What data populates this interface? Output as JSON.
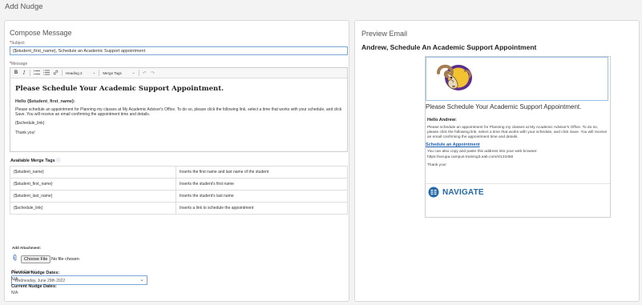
{
  "page": {
    "title": "Add Nudge"
  },
  "compose": {
    "title": "Compose Message",
    "subject_label": "Subject",
    "subject_value": "{$student_first_name}, Schedule an Academic Support appointment",
    "message_label": "Message",
    "toolbar": {
      "bold": "B",
      "italic": "I",
      "heading_select": "Heading 2",
      "merge_tags_select": "Merge Tags"
    },
    "editor": {
      "heading": "Please Schedule Your Academic Support Appointment.",
      "hello": "Hello {$student_first_name}:",
      "body": "Please schedule an appointment for Planning my classes at My Academic Advisor's Office. To do so, please click the following link, select a time that works with your schedule, and click Save. You will receive an email confirming the appointment time and details.",
      "link_tag": "{$schedule_link}",
      "thanks": "Thank you!"
    },
    "merge_tags_title": "Available Merge Tags",
    "merge_tags": [
      {
        "tag": "{$student_name}",
        "desc": "Inserts the first name and last name of the student"
      },
      {
        "tag": "{$student_first_name}",
        "desc": "Inserts the student's first name"
      },
      {
        "tag": "{$student_last_name}",
        "desc": "Inserts the student's last name"
      },
      {
        "tag": "{$schedule_link}",
        "desc": "Inserts a link to schedule the appointment"
      }
    ],
    "attachment_label": "Add Attachment:",
    "choose_file": "Choose File",
    "no_file": "No file chosen",
    "send_date_label": "Send Date",
    "send_date_value": "Wednesday, June 29th 2022",
    "prev_dates_label": "Previous Nudge Dates:",
    "prev_dates_value": "N/A",
    "curr_dates_label": "Current Nudge Dates:",
    "curr_dates_value": "N/A"
  },
  "preview": {
    "title": "Preview Email",
    "subject": "Andrew, Schedule An Academic Support Appointment",
    "email": {
      "heading": "Please Schedule Your Academic Support Appointment.",
      "hello": "Hello Andrew:",
      "body": "Please schedule an appointment for Planning my classes at My Academic Advisor's Office. To do so, please click the following link, select a time that works with your schedule, and click Save. You will receive an email confirming the appointment time and details.",
      "link_text": "Schedule an Appointment",
      "copy_text": "You can also copy and paste this address into your web browser.",
      "url": "https://wcupa.campus-training3.eab.com/s/123456",
      "thanks": "Thank you!",
      "brand": "NAVIGATE"
    }
  },
  "colors": {
    "accent": "#3b7dd8",
    "link": "#1a5fb4",
    "brand": "#2368a8"
  }
}
